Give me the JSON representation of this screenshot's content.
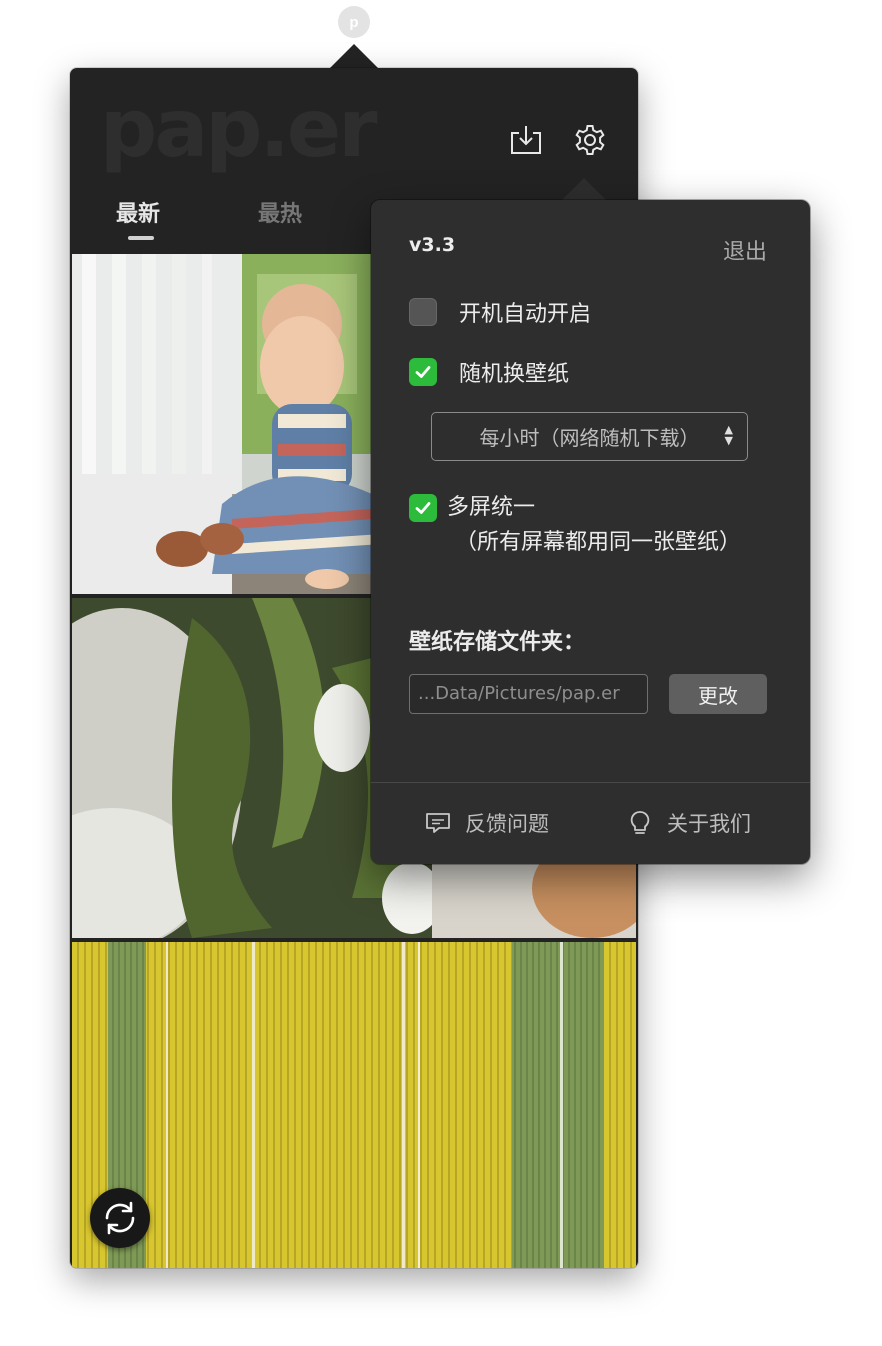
{
  "app": {
    "status_icon_letter": "p",
    "logo": "pap.er"
  },
  "header": {
    "download_icon": "download-tray-icon",
    "settings_icon": "gear-icon"
  },
  "tabs": [
    {
      "label": "最新",
      "active": true
    },
    {
      "label": "最热",
      "active": false
    }
  ],
  "gallery": {
    "items": [
      {
        "subject": "toddler-on-porch-photo"
      },
      {
        "subject": "white-tulips-photo"
      },
      {
        "subject": "yellow-green-stripes-photo"
      }
    ],
    "refresh_icon": "refresh-icon"
  },
  "settings": {
    "version": "v3.3",
    "quit_label": "退出",
    "autostart": {
      "label": "开机自动开启",
      "checked": false
    },
    "random_wallpaper": {
      "label": "随机换壁纸",
      "checked": true
    },
    "interval_select": {
      "selected": "每小时（网络随机下载）"
    },
    "multi_screen": {
      "label": "多屏统一",
      "description": "（所有屏幕都用同一张壁纸）",
      "checked": true
    },
    "folder_label": "壁纸存储文件夹：",
    "folder_path": "...Data/Pictures/pap.er",
    "change_label": "更改",
    "footer": {
      "feedback_label": "反馈问题",
      "feedback_icon": "chat-bubble-icon",
      "about_label": "关于我们",
      "about_icon": "lightbulb-icon"
    }
  },
  "colors": {
    "window_bg": "#232323",
    "panel_bg": "#2e2e2f",
    "checkbox_on": "#2dbb3c",
    "text_primary": "#ececec",
    "text_muted": "#777777"
  }
}
